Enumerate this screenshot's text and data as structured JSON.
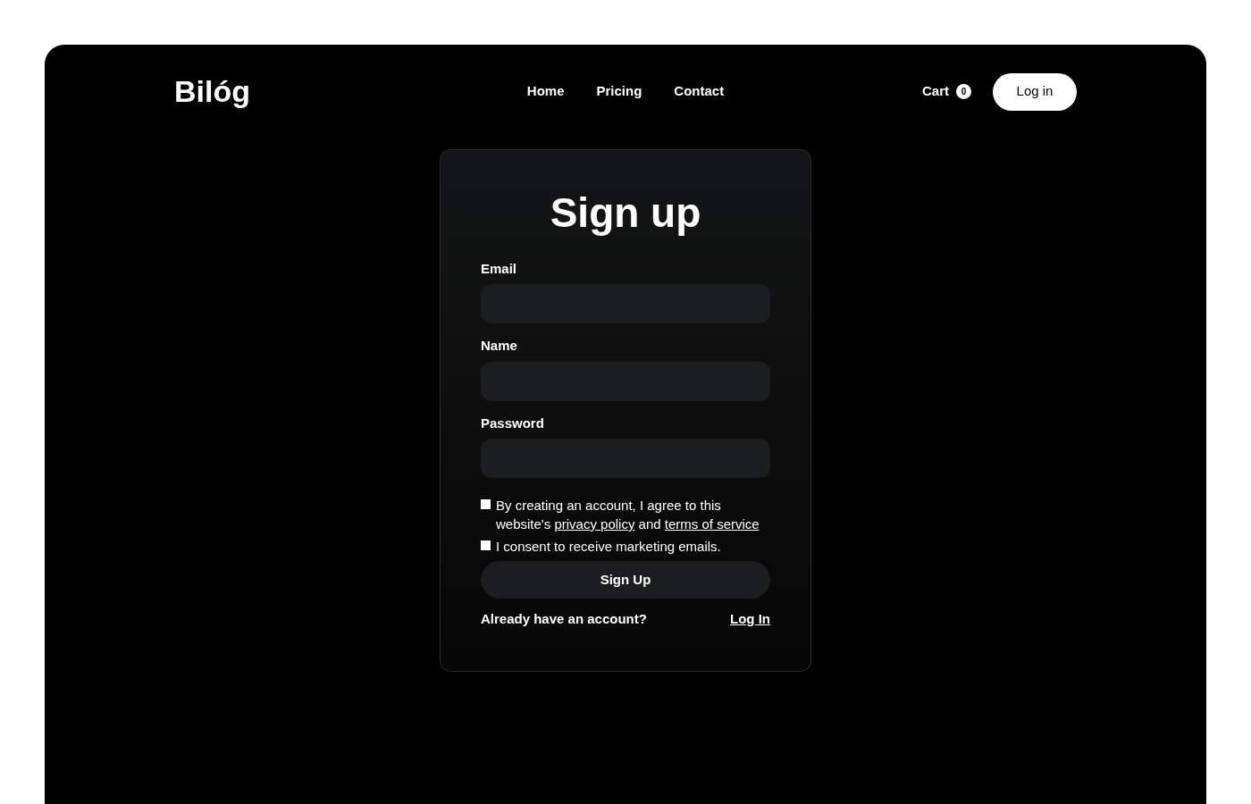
{
  "brand": "Bilóg",
  "nav": [
    {
      "label": "Home"
    },
    {
      "label": "Pricing"
    },
    {
      "label": "Contact"
    }
  ],
  "cart": {
    "label": "Cart",
    "count": "0"
  },
  "login_button": "Log in",
  "form": {
    "title": "Sign up",
    "fields": [
      {
        "label": "Email"
      },
      {
        "label": "Name"
      },
      {
        "label": "Password"
      }
    ],
    "agreements": [
      {
        "checked": false,
        "parts": [
          {
            "kind": "text",
            "text": "By creating an account, I agree to this website's "
          },
          {
            "kind": "link",
            "text": "privacy policy"
          },
          {
            "kind": "text",
            "text": " and "
          },
          {
            "kind": "link",
            "text": "terms of service"
          }
        ]
      },
      {
        "checked": false,
        "parts": [
          {
            "kind": "text",
            "text": "I consent to receive marketing emails."
          }
        ]
      }
    ],
    "submit": "Sign Up",
    "footer_text": "Already have an account?",
    "footer_link": "Log In"
  }
}
